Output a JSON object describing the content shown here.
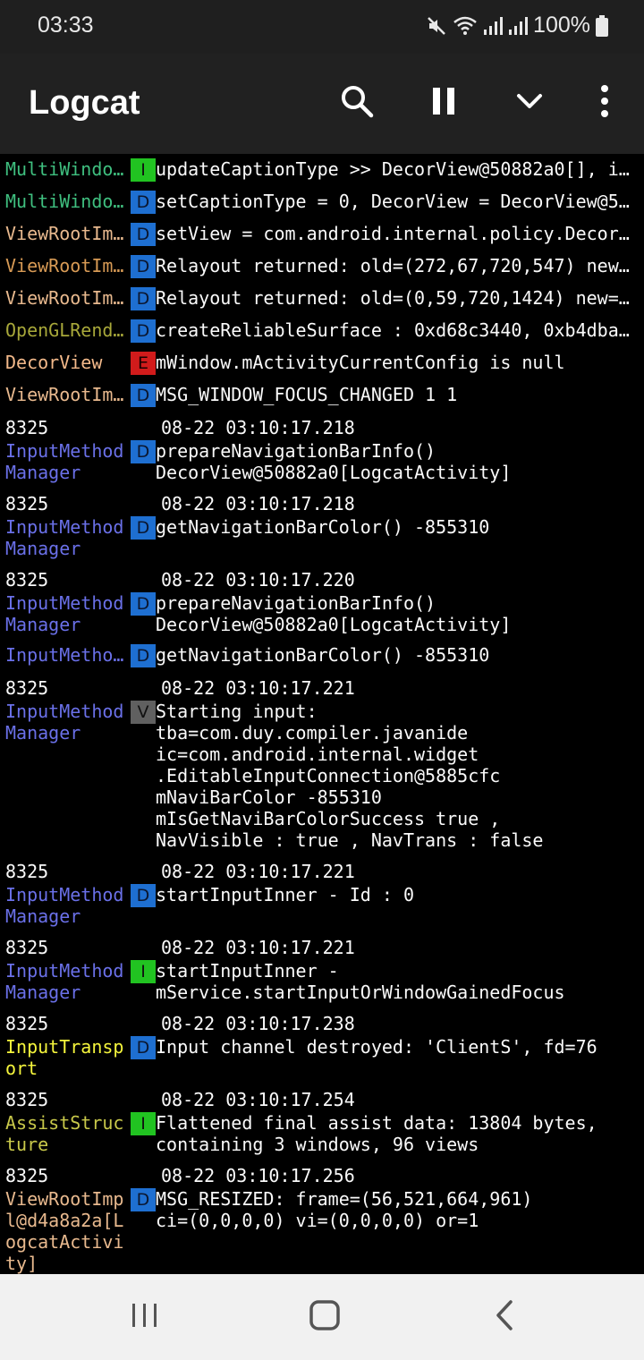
{
  "status": {
    "time": "03:33",
    "battery": "100%"
  },
  "appbar": {
    "title": "Logcat"
  },
  "colors": {
    "I": "#21c321",
    "D": "#1e6fd1",
    "E": "#d11b1b",
    "V": "#606060"
  },
  "entries": [
    {
      "tag": "MultiWindo…",
      "tagColor": "#3fbf7f",
      "level": "I",
      "msg": "updateCaptionType >> DecorView@50882a0[], i…",
      "compact": true
    },
    {
      "tag": "MultiWindo…",
      "tagColor": "#3fbf7f",
      "level": "D",
      "msg": "setCaptionType = 0, DecorView = DecorView@5…",
      "compact": true
    },
    {
      "tag": "ViewRootIm…",
      "tagColor": "#e8b98e",
      "level": "D",
      "msg": "setView = com.android.internal.policy.Decor…",
      "compact": true
    },
    {
      "tag": "ViewRootIm…",
      "tagColor": "#d79a55",
      "level": "D",
      "msg": "Relayout returned: old=(272,67,720,547) new…",
      "compact": true
    },
    {
      "tag": "ViewRootIm…",
      "tagColor": "#e8b98e",
      "level": "D",
      "msg": "Relayout returned: old=(0,59,720,1424) new=…",
      "compact": true
    },
    {
      "tag": "OpenGLRend…",
      "tagColor": "#a8a83a",
      "level": "D",
      "msg": "createReliableSurface : 0xd68c3440, 0xb4dba…",
      "compact": true
    },
    {
      "tag": "DecorView",
      "tagColor": "#f3b98a",
      "level": "E",
      "msg": "mWindow.mActivityCurrentConfig is null",
      "compact": true
    },
    {
      "tag": "ViewRootIm…",
      "tagColor": "#e8b98e",
      "level": "D",
      "msg": "MSG_WINDOW_FOCUS_CHANGED 1 1",
      "compact": true
    },
    {
      "pid": "8325",
      "time": "08-22 03:10:17.218",
      "tag": "InputMethod\nManager",
      "tagColor": "#6a70e8",
      "level": "D",
      "msg": "prepareNavigationBarInfo()\nDecorView@50882a0[LogcatActivity]"
    },
    {
      "pid": "8325",
      "time": "08-22 03:10:17.218",
      "tag": "InputMethod\nManager",
      "tagColor": "#6a70e8",
      "level": "D",
      "msg": "getNavigationBarColor() -855310"
    },
    {
      "pid": "8325",
      "time": "08-22 03:10:17.220",
      "tag": "InputMethod\nManager",
      "tagColor": "#6a70e8",
      "level": "D",
      "msg": "prepareNavigationBarInfo()\nDecorView@50882a0[LogcatActivity]"
    },
    {
      "tag": "InputMetho…",
      "tagColor": "#6a70e8",
      "level": "D",
      "msg": "getNavigationBarColor() -855310",
      "compact": true
    },
    {
      "pid": "8325",
      "time": "08-22 03:10:17.221",
      "tag": "InputMethod\nManager",
      "tagColor": "#6a70e8",
      "level": "V",
      "msg": "Starting input:\ntba=com.duy.compiler.javanide\nic=com.android.internal.widget\n.EditableInputConnection@5885cfc\nmNaviBarColor -855310\nmIsGetNaviBarColorSuccess true ,\nNavVisible : true , NavTrans : false"
    },
    {
      "pid": "8325",
      "time": "08-22 03:10:17.221",
      "tag": "InputMethod\nManager",
      "tagColor": "#6a70e8",
      "level": "D",
      "msg": "startInputInner - Id : 0"
    },
    {
      "pid": "8325",
      "time": "08-22 03:10:17.221",
      "tag": "InputMethod\nManager",
      "tagColor": "#6a70e8",
      "level": "I",
      "msg": "startInputInner -\nmService.startInputOrWindowGainedFocus"
    },
    {
      "pid": "8325",
      "time": "08-22 03:10:17.238",
      "tag": "InputTransp\nort",
      "tagColor": "#f5f53c",
      "level": "D",
      "msg": "Input channel destroyed: 'ClientS', fd=76"
    },
    {
      "pid": "8325",
      "time": "08-22 03:10:17.254",
      "tag": "AssistStruc\nture",
      "tagColor": "#c8c84a",
      "level": "I",
      "msg": "Flattened final assist data: 13804 bytes,\ncontaining 3 windows, 96 views"
    },
    {
      "pid": "8325",
      "time": "08-22 03:10:17.256",
      "tag": "ViewRootImp\nl@d4a8a2a[L\nogcatActivi\nty]",
      "tagColor": "#e8b98e",
      "level": "D",
      "msg": "MSG_RESIZED: frame=(56,521,664,961)\nci=(0,0,0,0) vi=(0,0,0,0) or=1"
    }
  ]
}
